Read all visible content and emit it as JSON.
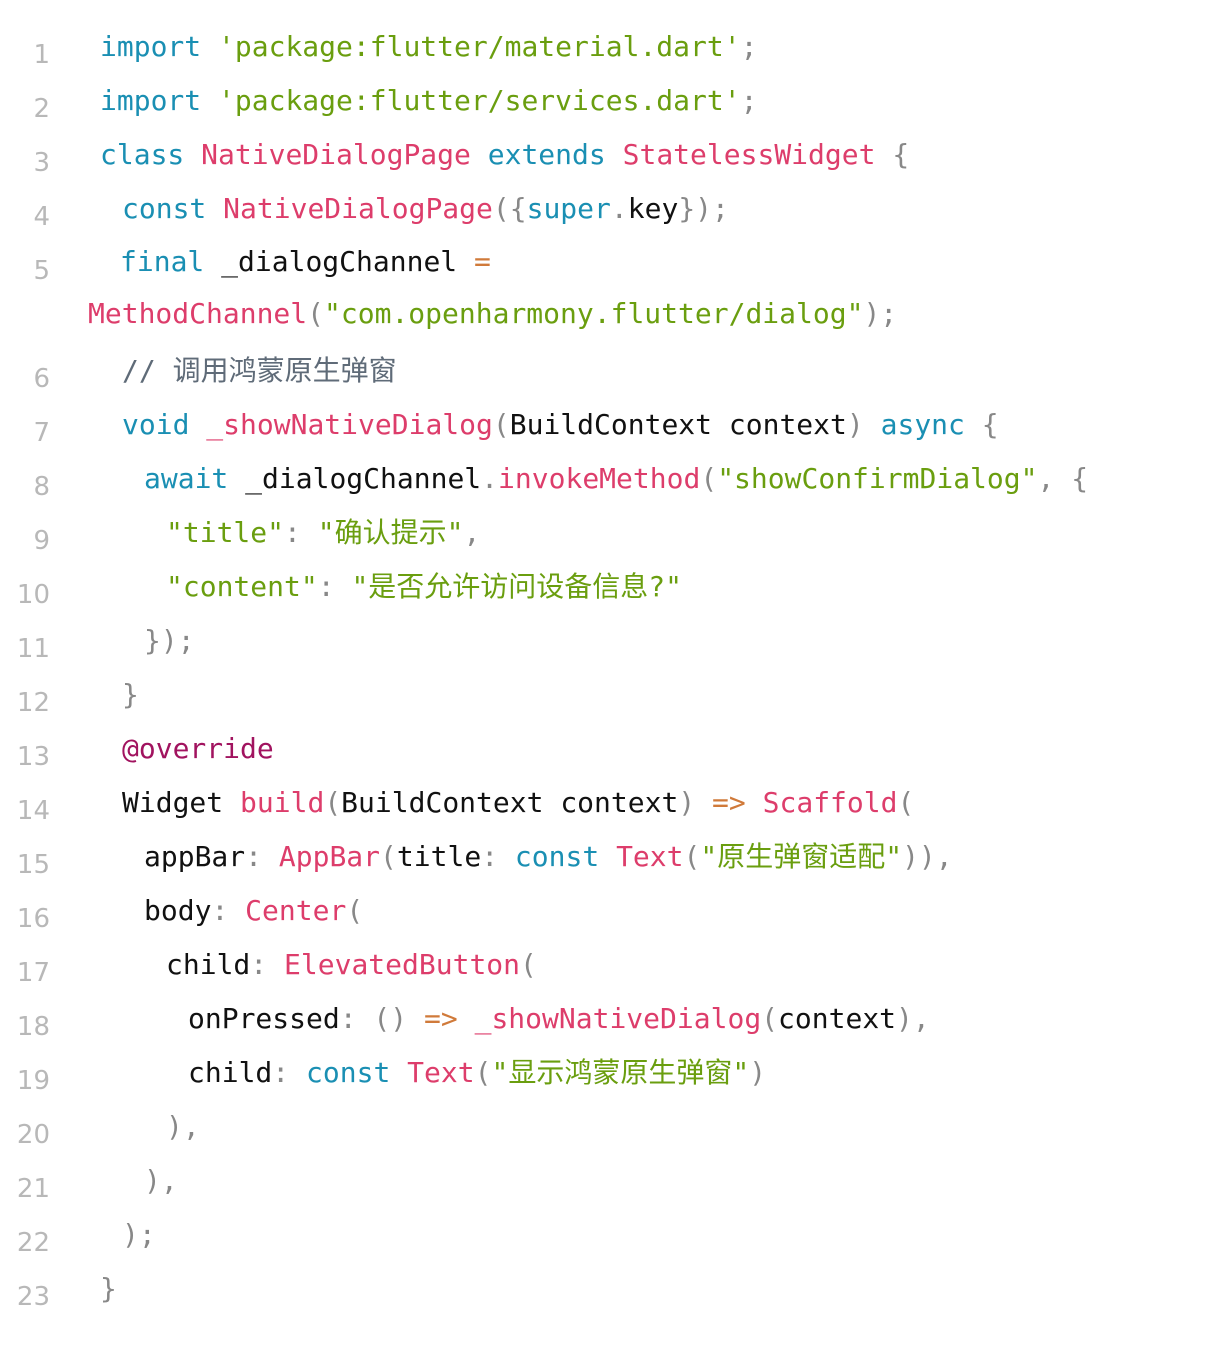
{
  "editor": {
    "lines": [
      {
        "n": "1",
        "indent": 0,
        "tokens": [
          {
            "t": "import",
            "c": "kw"
          },
          {
            "t": " ",
            "c": "plain"
          },
          {
            "t": "'package:flutter/material.dart'",
            "c": "str"
          },
          {
            "t": ";",
            "c": "punc"
          }
        ]
      },
      {
        "n": "2",
        "indent": 0,
        "tokens": [
          {
            "t": "import",
            "c": "kw"
          },
          {
            "t": " ",
            "c": "plain"
          },
          {
            "t": "'package:flutter/services.dart'",
            "c": "str"
          },
          {
            "t": ";",
            "c": "punc"
          }
        ]
      },
      {
        "n": "3",
        "indent": 0,
        "tokens": [
          {
            "t": "class",
            "c": "kw"
          },
          {
            "t": " ",
            "c": "plain"
          },
          {
            "t": "NativeDialogPage",
            "c": "cls"
          },
          {
            "t": " ",
            "c": "plain"
          },
          {
            "t": "extends",
            "c": "kw"
          },
          {
            "t": " ",
            "c": "plain"
          },
          {
            "t": "StatelessWidget",
            "c": "cls"
          },
          {
            "t": " ",
            "c": "plain"
          },
          {
            "t": "{",
            "c": "punc"
          }
        ]
      },
      {
        "n": "4",
        "indent": 1,
        "tokens": [
          {
            "t": "const",
            "c": "kw"
          },
          {
            "t": " ",
            "c": "plain"
          },
          {
            "t": "NativeDialogPage",
            "c": "cls"
          },
          {
            "t": "({",
            "c": "punc"
          },
          {
            "t": "super",
            "c": "kw"
          },
          {
            "t": ".",
            "c": "punc"
          },
          {
            "t": "key",
            "c": "plain"
          },
          {
            "t": "});",
            "c": "punc"
          }
        ]
      },
      {
        "n": "5",
        "indent": 1,
        "wrap": true,
        "tokens": [
          {
            "t": "final",
            "c": "kw"
          },
          {
            "t": " _dialogChannel ",
            "c": "plain"
          },
          {
            "t": "=",
            "c": "op"
          },
          {
            "t": " ",
            "c": "plain"
          },
          {
            "t": "MethodChannel",
            "c": "cls"
          },
          {
            "t": "(",
            "c": "punc"
          },
          {
            "t": "\"com.openharmony.flutter/dialog\"",
            "c": "str"
          },
          {
            "t": ");",
            "c": "punc"
          }
        ]
      },
      {
        "n": "6",
        "indent": 1,
        "tokens": [
          {
            "t": "// 调用鸿蒙原生弹窗",
            "c": "cmt"
          }
        ]
      },
      {
        "n": "7",
        "indent": 1,
        "tokens": [
          {
            "t": "void",
            "c": "kw"
          },
          {
            "t": " ",
            "c": "plain"
          },
          {
            "t": "_showNativeDialog",
            "c": "cls"
          },
          {
            "t": "(",
            "c": "punc"
          },
          {
            "t": "BuildContext context",
            "c": "plain"
          },
          {
            "t": ")",
            "c": "punc"
          },
          {
            "t": " ",
            "c": "plain"
          },
          {
            "t": "async",
            "c": "kw"
          },
          {
            "t": " ",
            "c": "plain"
          },
          {
            "t": "{",
            "c": "punc"
          }
        ]
      },
      {
        "n": "8",
        "indent": 2,
        "tokens": [
          {
            "t": "await",
            "c": "kw"
          },
          {
            "t": " _dialogChannel",
            "c": "plain"
          },
          {
            "t": ".",
            "c": "punc"
          },
          {
            "t": "invokeMethod",
            "c": "cls"
          },
          {
            "t": "(",
            "c": "punc"
          },
          {
            "t": "\"showConfirmDialog\"",
            "c": "str"
          },
          {
            "t": ", {",
            "c": "punc"
          }
        ]
      },
      {
        "n": "9",
        "indent": 3,
        "tokens": [
          {
            "t": "\"title\"",
            "c": "str"
          },
          {
            "t": ": ",
            "c": "punc"
          },
          {
            "t": "\"确认提示\"",
            "c": "str"
          },
          {
            "t": ",",
            "c": "punc"
          }
        ]
      },
      {
        "n": "10",
        "indent": 3,
        "tokens": [
          {
            "t": "\"content\"",
            "c": "str"
          },
          {
            "t": ": ",
            "c": "punc"
          },
          {
            "t": "\"是否允许访问设备信息?\"",
            "c": "str"
          }
        ]
      },
      {
        "n": "11",
        "indent": 2,
        "tokens": [
          {
            "t": "});",
            "c": "punc"
          }
        ]
      },
      {
        "n": "12",
        "indent": 1,
        "tokens": [
          {
            "t": "}",
            "c": "punc"
          }
        ]
      },
      {
        "n": "13",
        "indent": 1,
        "tokens": [
          {
            "t": "@override",
            "c": "ann"
          }
        ]
      },
      {
        "n": "14",
        "indent": 1,
        "tokens": [
          {
            "t": "Widget",
            "c": "plain"
          },
          {
            "t": " ",
            "c": "plain"
          },
          {
            "t": "build",
            "c": "cls"
          },
          {
            "t": "(",
            "c": "punc"
          },
          {
            "t": "BuildContext context",
            "c": "plain"
          },
          {
            "t": ")",
            "c": "punc"
          },
          {
            "t": " ",
            "c": "plain"
          },
          {
            "t": "=>",
            "c": "op"
          },
          {
            "t": " ",
            "c": "plain"
          },
          {
            "t": "Scaffold",
            "c": "cls"
          },
          {
            "t": "(",
            "c": "punc"
          }
        ]
      },
      {
        "n": "15",
        "indent": 2,
        "tokens": [
          {
            "t": "appBar",
            "c": "plain"
          },
          {
            "t": ": ",
            "c": "punc"
          },
          {
            "t": "AppBar",
            "c": "cls"
          },
          {
            "t": "(",
            "c": "punc"
          },
          {
            "t": "title",
            "c": "plain"
          },
          {
            "t": ": ",
            "c": "punc"
          },
          {
            "t": "const",
            "c": "kw"
          },
          {
            "t": " ",
            "c": "plain"
          },
          {
            "t": "Text",
            "c": "cls"
          },
          {
            "t": "(",
            "c": "punc"
          },
          {
            "t": "\"原生弹窗适配\"",
            "c": "str"
          },
          {
            "t": ")),",
            "c": "punc"
          }
        ]
      },
      {
        "n": "16",
        "indent": 2,
        "tokens": [
          {
            "t": "body",
            "c": "plain"
          },
          {
            "t": ": ",
            "c": "punc"
          },
          {
            "t": "Center",
            "c": "cls"
          },
          {
            "t": "(",
            "c": "punc"
          }
        ]
      },
      {
        "n": "17",
        "indent": 3,
        "tokens": [
          {
            "t": "child",
            "c": "plain"
          },
          {
            "t": ": ",
            "c": "punc"
          },
          {
            "t": "ElevatedButton",
            "c": "cls"
          },
          {
            "t": "(",
            "c": "punc"
          }
        ]
      },
      {
        "n": "18",
        "indent": 4,
        "tokens": [
          {
            "t": "onPressed",
            "c": "plain"
          },
          {
            "t": ": () ",
            "c": "punc"
          },
          {
            "t": "=>",
            "c": "op"
          },
          {
            "t": " ",
            "c": "plain"
          },
          {
            "t": "_showNativeDialog",
            "c": "cls"
          },
          {
            "t": "(",
            "c": "punc"
          },
          {
            "t": "context",
            "c": "plain"
          },
          {
            "t": "),",
            "c": "punc"
          }
        ]
      },
      {
        "n": "19",
        "indent": 4,
        "tokens": [
          {
            "t": "child",
            "c": "plain"
          },
          {
            "t": ": ",
            "c": "punc"
          },
          {
            "t": "const",
            "c": "kw"
          },
          {
            "t": " ",
            "c": "plain"
          },
          {
            "t": "Text",
            "c": "cls"
          },
          {
            "t": "(",
            "c": "punc"
          },
          {
            "t": "\"显示鸿蒙原生弹窗\"",
            "c": "str"
          },
          {
            "t": ")",
            "c": "punc"
          }
        ]
      },
      {
        "n": "20",
        "indent": 3,
        "tokens": [
          {
            "t": "),",
            "c": "punc"
          }
        ]
      },
      {
        "n": "21",
        "indent": 2,
        "tokens": [
          {
            "t": "),",
            "c": "punc"
          }
        ]
      },
      {
        "n": "22",
        "indent": 1,
        "tokens": [
          {
            "t": ");",
            "c": "punc"
          }
        ]
      },
      {
        "n": "23",
        "indent": 0,
        "tokens": [
          {
            "t": "}",
            "c": "punc"
          }
        ]
      }
    ]
  },
  "colors": {
    "keyword": "#1a8fb3",
    "class": "#dd3d6b",
    "string": "#6a9e0f",
    "plain": "#111111",
    "punctuation": "#888888",
    "comment": "#5f6b78",
    "annotation": "#a1135f",
    "operator": "#d07a3a",
    "line_number": "#b8b8b8"
  }
}
